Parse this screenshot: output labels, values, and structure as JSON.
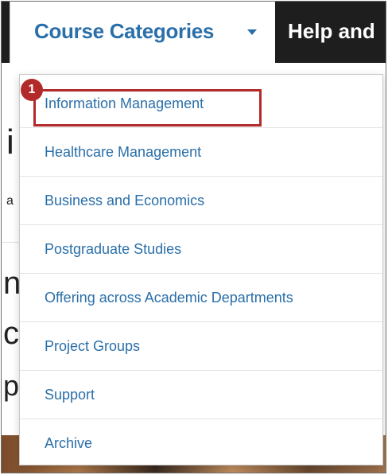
{
  "nav": {
    "active_label": "Course Categories",
    "next_label": "Help and"
  },
  "background": {
    "frag_1": "i",
    "frag_2": "a",
    "frag_3": "n",
    "frag_4": "c",
    "frag_5": "p"
  },
  "dropdown": {
    "items": [
      "Information Management",
      "Healthcare Management",
      "Business and Economics",
      "Postgraduate Studies",
      "Offering across Academic Departments",
      "Project Groups",
      "Support",
      "Archive"
    ]
  },
  "annotation": {
    "step_number": "1",
    "highlight_color": "#b22a2a"
  },
  "colors": {
    "link": "#2a6fa9",
    "navbar": "#1e1e1e"
  }
}
